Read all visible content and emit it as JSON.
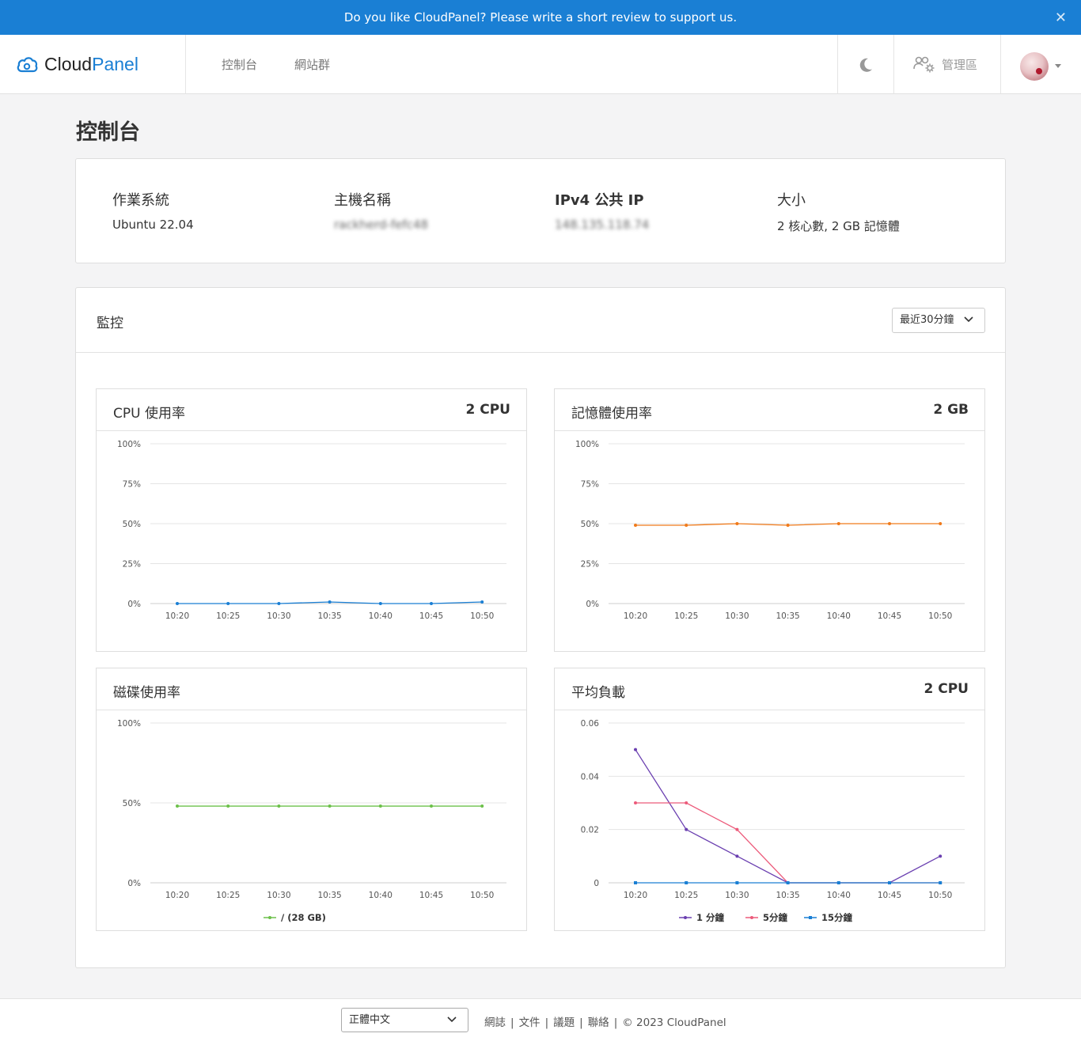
{
  "banner": {
    "text": "Do you like CloudPanel? Please write a short review to support us.",
    "close": "✕"
  },
  "brand": {
    "name_a": "Cloud",
    "name_b": "Panel",
    "accent_color": "#1a7fd4"
  },
  "nav": {
    "items": [
      "控制台",
      "網站群"
    ],
    "admin_label": "管理區"
  },
  "page": {
    "title": "控制台"
  },
  "server_info": {
    "os_label": "作業系統",
    "os_value": "Ubuntu 22.04",
    "host_label": "主機名稱",
    "host_value": "rackherd-fefc48",
    "ip_label": "IPv4 公共 IP",
    "ip_value": "148.135.118.74",
    "size_label": "大小",
    "size_value": "2 核心數, 2 GB 記憶體"
  },
  "monitor": {
    "title": "監控",
    "range": "最近30分鐘"
  },
  "charts": {
    "cpu": {
      "title": "CPU 使用率",
      "badge": "2 CPU"
    },
    "memory": {
      "title": "記憶體使用率",
      "badge": "2 GB"
    },
    "disk": {
      "title": "磁碟使用率",
      "badge": "",
      "legend": "/ (28 GB)"
    },
    "load": {
      "title": "平均負載",
      "badge": "2 CPU",
      "legend": [
        "1 分鐘",
        "5分鐘",
        "15分鐘"
      ]
    }
  },
  "chart_data": [
    {
      "id": "cpu",
      "type": "line",
      "x": [
        "10:20",
        "10:25",
        "10:30",
        "10:35",
        "10:40",
        "10:45",
        "10:50"
      ],
      "yticks": [
        "0%",
        "25%",
        "50%",
        "75%",
        "100%"
      ],
      "ylim": [
        0,
        100
      ],
      "series": [
        {
          "color": "#1a7fd4",
          "values": [
            0,
            0,
            0,
            1,
            0,
            0,
            1
          ]
        }
      ]
    },
    {
      "id": "memory",
      "type": "line",
      "x": [
        "10:20",
        "10:25",
        "10:30",
        "10:35",
        "10:40",
        "10:45",
        "10:50"
      ],
      "yticks": [
        "0%",
        "25%",
        "50%",
        "75%",
        "100%"
      ],
      "ylim": [
        0,
        100
      ],
      "series": [
        {
          "color": "#f07a1a",
          "values": [
            49,
            49,
            50,
            49,
            50,
            50,
            50
          ]
        }
      ]
    },
    {
      "id": "disk",
      "type": "line",
      "x": [
        "10:20",
        "10:25",
        "10:30",
        "10:35",
        "10:40",
        "10:45",
        "10:50"
      ],
      "yticks": [
        "0%",
        "50%",
        "100%"
      ],
      "ylim": [
        0,
        100
      ],
      "series": [
        {
          "name": "/ (28 GB)",
          "color": "#6cc04a",
          "values": [
            48,
            48,
            48,
            48,
            48,
            48,
            48
          ]
        }
      ]
    },
    {
      "id": "load",
      "type": "line",
      "x": [
        "10:20",
        "10:25",
        "10:30",
        "10:35",
        "10:40",
        "10:45",
        "10:50"
      ],
      "yticks": [
        "0",
        "0.02",
        "0.04",
        "0.06"
      ],
      "ylim": [
        0,
        0.06
      ],
      "series": [
        {
          "name": "1 分鐘",
          "color": "#6a3fb0",
          "values": [
            0.05,
            0.02,
            0.01,
            0,
            0,
            0,
            0.01
          ]
        },
        {
          "name": "5分鐘",
          "color": "#ec5a7a",
          "values": [
            0.03,
            0.03,
            0.02,
            0,
            0,
            0,
            0
          ]
        },
        {
          "name": "15分鐘",
          "color": "#1a7fd4",
          "values": [
            0,
            0,
            0,
            0,
            0,
            0,
            0
          ]
        }
      ]
    }
  ],
  "footer": {
    "language": "正體中文",
    "links": [
      "網誌",
      "文件",
      "議題",
      "聯絡"
    ],
    "copyright": "© 2023  CloudPanel"
  }
}
